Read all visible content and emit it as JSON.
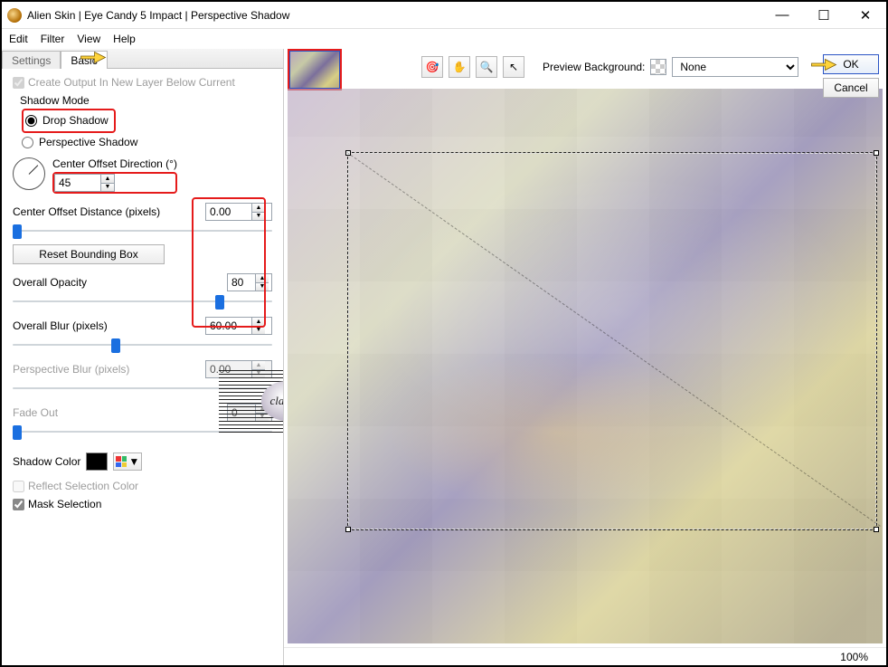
{
  "window": {
    "title": "Alien Skin | Eye Candy 5 Impact | Perspective Shadow"
  },
  "menubar": {
    "edit": "Edit",
    "filter": "Filter",
    "view": "View",
    "help": "Help"
  },
  "tabs": {
    "settings": "Settings",
    "basic": "Basic"
  },
  "controls": {
    "create_output_label": "Create Output In New Layer Below Current",
    "shadow_mode_label": "Shadow Mode",
    "drop_shadow": "Drop Shadow",
    "perspective_shadow": "Perspective Shadow",
    "center_offset_direction_label": "Center Offset Direction (°)",
    "center_offset_direction_value": "45",
    "center_offset_distance_label": "Center Offset Distance (pixels)",
    "center_offset_distance_value": "0.00",
    "reset_bounding_box": "Reset Bounding Box",
    "overall_opacity_label": "Overall Opacity",
    "overall_opacity_value": "80",
    "overall_blur_label": "Overall Blur (pixels)",
    "overall_blur_value": "60.00",
    "perspective_blur_label": "Perspective Blur (pixels)",
    "perspective_blur_value": "0.00",
    "fade_out_label": "Fade Out",
    "fade_out_value": "0",
    "shadow_color_label": "Shadow Color",
    "reflect_selection_label": "Reflect Selection Color",
    "mask_selection_label": "Mask Selection"
  },
  "toolbar": {
    "preview_bg_label": "Preview Background:",
    "preview_bg_value": "None"
  },
  "buttons": {
    "ok": "OK",
    "cancel": "Cancel"
  },
  "status": {
    "zoom": "100%"
  },
  "watermark": {
    "text": "claudia"
  },
  "icons": {
    "pan": "✋",
    "zoom": "🔍",
    "pointer": "↖",
    "eyedrop": "🎯"
  }
}
